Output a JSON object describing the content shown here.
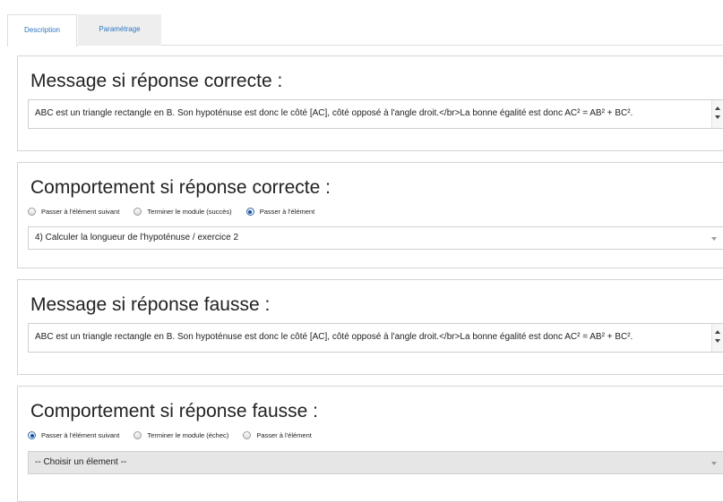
{
  "tabs": [
    {
      "label": "Description"
    },
    {
      "label": "Paramétrage"
    }
  ],
  "msg_correct": {
    "title": "Message si réponse correcte :",
    "text": "ABC est un triangle rectangle en B. Son hypoténuse est donc le côté [AC], côté opposé à l'angle droit.</br>La bonne égalité est donc AC² = AB² + BC²."
  },
  "comp_correct": {
    "title": "Comportement si réponse correcte :",
    "options": [
      "Passer à l'élément suivant",
      "Terminer le module (succès)",
      "Passer à l'élément"
    ],
    "selected_index": 2,
    "select_value": "4) Calculer la longueur de l'hypoténuse / exercice 2"
  },
  "msg_wrong": {
    "title": "Message si réponse fausse :",
    "text": "ABC est un triangle rectangle en B. Son hypoténuse est donc le côté [AC], côté opposé à l'angle droit.</br>La bonne égalité est donc AC² = AB² + BC²."
  },
  "comp_wrong": {
    "title": "Comportement si réponse fausse :",
    "options": [
      "Passer à l'élément suivant",
      "Terminer le module (échec)",
      "Passer à l'élément"
    ],
    "selected_index": 0,
    "select_value": "-- Choisir un élement --"
  }
}
